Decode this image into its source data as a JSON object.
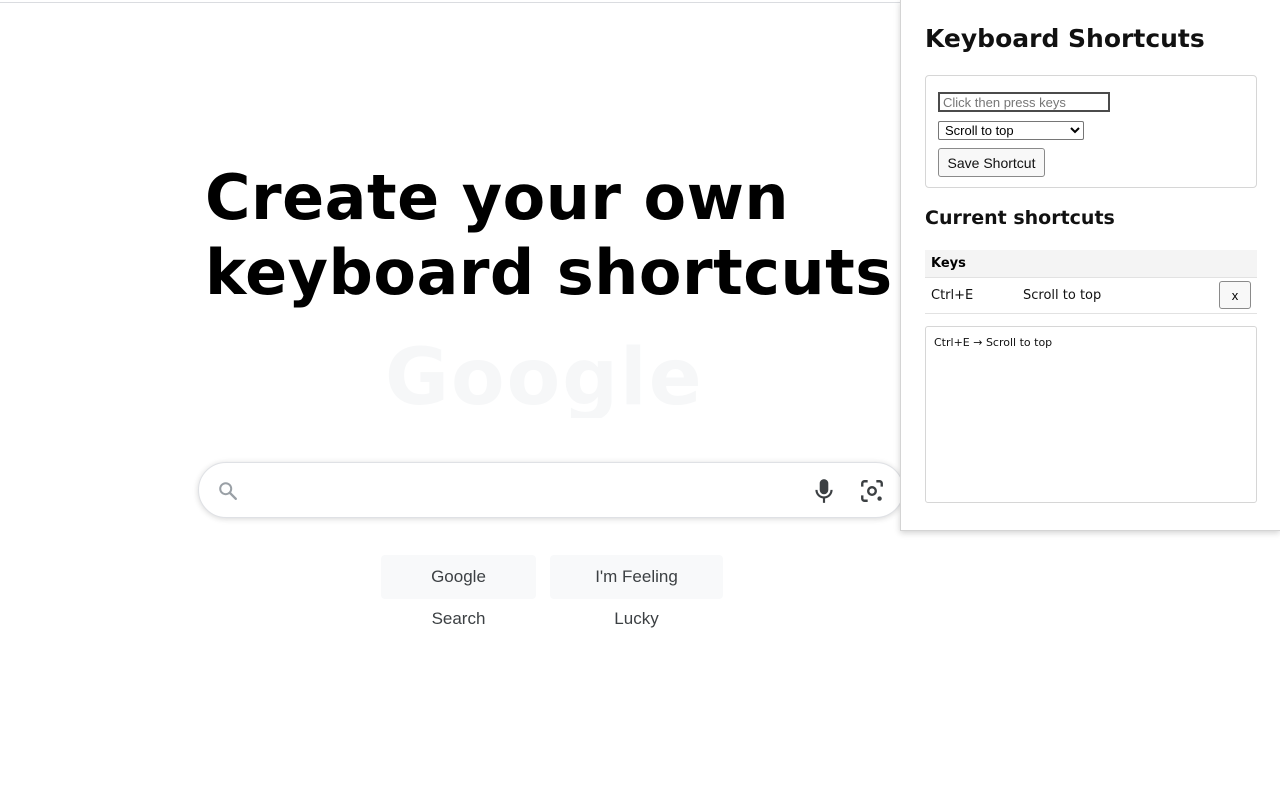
{
  "hero": {
    "line1": "Create your own",
    "line2": "keyboard shortcuts"
  },
  "background_logo": "Google",
  "search": {
    "value": "",
    "icons": [
      "search-icon",
      "mic-icon",
      "camera-lens-icon"
    ]
  },
  "buttons": {
    "google_search": "Google Search",
    "feeling_lucky": "I'm Feeling Lucky"
  },
  "panel": {
    "title": "Keyboard Shortcuts",
    "keys_placeholder": "Click then press keys",
    "keys_value": "",
    "action_selected": "Scroll to top",
    "save_label": "Save Shortcut",
    "current_title": "Current shortcuts",
    "table": {
      "headers": [
        "Keys",
        "",
        ""
      ],
      "rows": [
        {
          "keys": "Ctrl+E",
          "action": "Scroll to top",
          "delete_label": "x"
        }
      ]
    },
    "log": "Ctrl+E → Scroll to top"
  },
  "colors": {
    "search_border": "#dfe1e5",
    "button_bg": "#f8f9fa",
    "button_text": "#3c4043"
  }
}
